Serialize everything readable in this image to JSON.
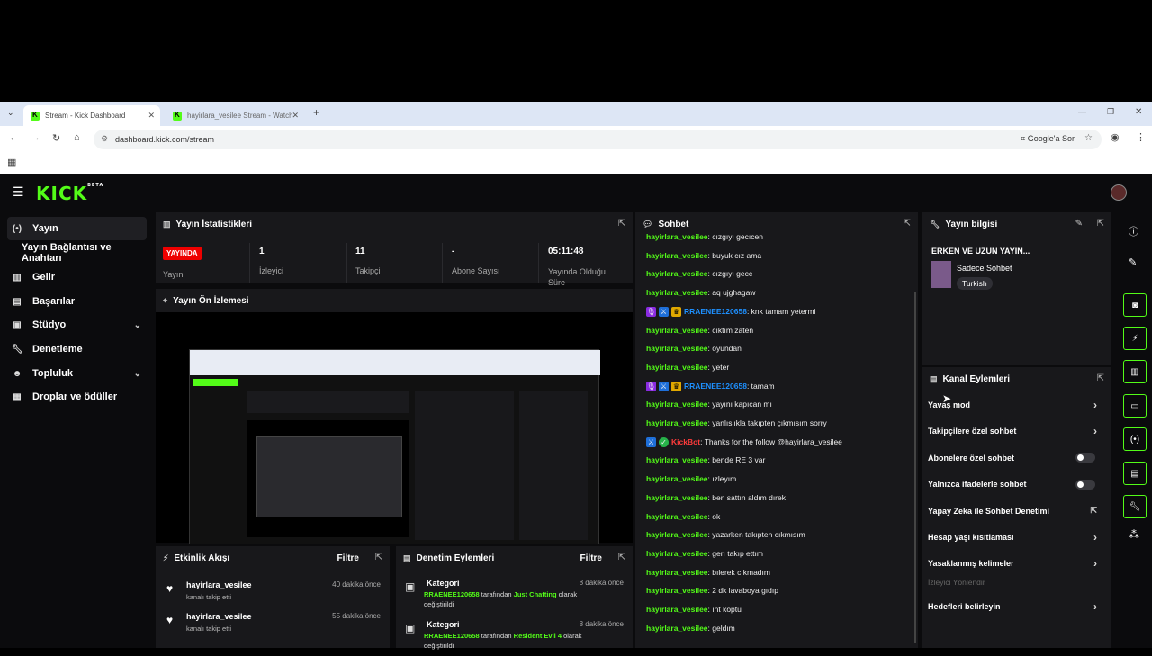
{
  "browser": {
    "tabs": [
      {
        "label": "Stream - Kick Dashboard"
      },
      {
        "label": "hayirlara_vesilee Stream - Watch"
      }
    ],
    "url": "dashboard.kick.com/stream",
    "google_btn": "Google'a Sor"
  },
  "app": {
    "logo": "KICK",
    "logo_sup": "BETA"
  },
  "sidebar": {
    "items": [
      {
        "label": "Yayın",
        "icon": "broadcast-icon"
      },
      {
        "label": "Yayın Bağlantısı ve Anahtarı",
        "icon": ""
      },
      {
        "label": "Gelir",
        "icon": "chart-icon"
      },
      {
        "label": "Başarılar",
        "icon": "trophy-icon"
      },
      {
        "label": "Stüdyo",
        "icon": "studio-icon"
      },
      {
        "label": "Denetleme",
        "icon": "wrench-icon"
      },
      {
        "label": "Topluluk",
        "icon": "people-icon"
      },
      {
        "label": "Droplar ve ödüller",
        "icon": "gift-icon"
      }
    ]
  },
  "stats": {
    "title": "Yayın İstatistikleri",
    "live_badge": "YAYINDA",
    "cells": [
      {
        "value": "",
        "label": "Yayın"
      },
      {
        "value": "1",
        "label": "İzleyici"
      },
      {
        "value": "11",
        "label": "Takipçi"
      },
      {
        "value": "-",
        "label": "Abone Sayısı"
      },
      {
        "value": "05:11:48",
        "label": "Yayında Olduğu Süre"
      }
    ]
  },
  "preview": {
    "title": "Yayın Ön İzlemesi"
  },
  "activity": {
    "title": "Etkinlik Akışı",
    "filter": "Filtre",
    "items": [
      {
        "name": "hayirlara_vesilee",
        "sub": "kanalı takip etti",
        "time": "40 dakika önce"
      },
      {
        "name": "hayirlara_vesilee",
        "sub": "kanalı takip etti",
        "time": "55 dakika önce"
      }
    ]
  },
  "moderation": {
    "title": "Denetim Eylemleri",
    "filter": "Filtre",
    "items": [
      {
        "title": "Kategori",
        "user": "RRAENEE120658",
        "mid": " tarafından ",
        "cat": "Just Chatting",
        "tail": " olarak",
        "tail2": "değiştirildi",
        "time": "8 dakika önce"
      },
      {
        "title": "Kategori",
        "user": "RRAENEE120658",
        "mid": " tarafından ",
        "cat": "Resident Evil 4",
        "tail": " olarak",
        "tail2": "değiştirildi",
        "time": "8 dakika önce"
      }
    ]
  },
  "chat": {
    "title": "Sohbet",
    "messages": [
      {
        "user": "hayirlara_vesilee",
        "text": ": cızgıyı gecıcen",
        "kind": "green"
      },
      {
        "user": "hayirlara_vesilee",
        "text": ": buyuk cız ama",
        "kind": "green"
      },
      {
        "user": "hayirlara_vesilee",
        "text": ": cızgıyı gecc",
        "kind": "green"
      },
      {
        "user": "hayirlara_vesilee",
        "text": ": aq ujghagaw",
        "kind": "green"
      },
      {
        "user": "RRAENEE120658",
        "text": ": knk tamam yetermi",
        "kind": "blue"
      },
      {
        "user": "hayirlara_vesilee",
        "text": ": cıktım zaten",
        "kind": "green"
      },
      {
        "user": "hayirlara_vesilee",
        "text": ": oyundan",
        "kind": "green"
      },
      {
        "user": "hayirlara_vesilee",
        "text": ": yeter",
        "kind": "green"
      },
      {
        "user": "RRAENEE120658",
        "text": ": tamam",
        "kind": "blue"
      },
      {
        "user": "hayirlara_vesilee",
        "text": ": yayını kapıcan mı",
        "kind": "green"
      },
      {
        "user": "hayirlara_vesilee",
        "text": ": yanlıslıkla takıpten çıkmısım sorry",
        "kind": "green"
      },
      {
        "user": "KickBot",
        "text": ": Thanks for the follow @hayirlara_vesilee",
        "kind": "red"
      },
      {
        "user": "hayirlara_vesilee",
        "text": ": bende RE 3 var",
        "kind": "green"
      },
      {
        "user": "hayirlara_vesilee",
        "text": ": ızleyım",
        "kind": "green"
      },
      {
        "user": "hayirlara_vesilee",
        "text": ": ben sattın aldım dırek",
        "kind": "green"
      },
      {
        "user": "hayirlara_vesilee",
        "text": ": ok",
        "kind": "green"
      },
      {
        "user": "hayirlara_vesilee",
        "text": ": yazarken takıpten cıkmısım",
        "kind": "green"
      },
      {
        "user": "hayirlara_vesilee",
        "text": ": gerı takıp ettım",
        "kind": "green"
      },
      {
        "user": "hayirlara_vesilee",
        "text": ": bılerek cıkmadım",
        "kind": "green"
      },
      {
        "user": "hayirlara_vesilee",
        "text": ": 2 dk lavaboya gıdıp",
        "kind": "green"
      },
      {
        "user": "hayirlara_vesilee",
        "text": ": ınt koptu",
        "kind": "green"
      },
      {
        "user": "hayirlara_vesilee",
        "text": ": geldım",
        "kind": "green"
      }
    ]
  },
  "info": {
    "title": "Yayın bilgisi",
    "stream_title": "ERKEN VE UZUN YAYIN...",
    "category": "Sadece Sohbet",
    "tag": "Turkish"
  },
  "actions": {
    "title": "Kanal Eylemleri",
    "rows": [
      {
        "label": "Yavaş mod",
        "ctrl": "arrow"
      },
      {
        "label": "Takipçilere özel sohbet",
        "ctrl": "arrow"
      },
      {
        "label": "Abonelere özel sohbet",
        "ctrl": "toggle"
      },
      {
        "label": "Yalnızca ifadelerle sohbet",
        "ctrl": "toggle"
      },
      {
        "label": "Yapay Zeka ile Sohbet Denetimi",
        "ctrl": "ext"
      },
      {
        "label": "Hesap yaşı kısıtlaması",
        "ctrl": "arrow"
      },
      {
        "label": "Yasaklanmış kelimeler",
        "ctrl": "arrow"
      }
    ],
    "section_label": "İzleyici Yönlendir",
    "last_row": "Hedefleri belirleyin"
  },
  "colors": {
    "accent": "#53fc18",
    "live": "#ee0000",
    "bg": "#0b0b0d",
    "panel": "#18181b"
  }
}
